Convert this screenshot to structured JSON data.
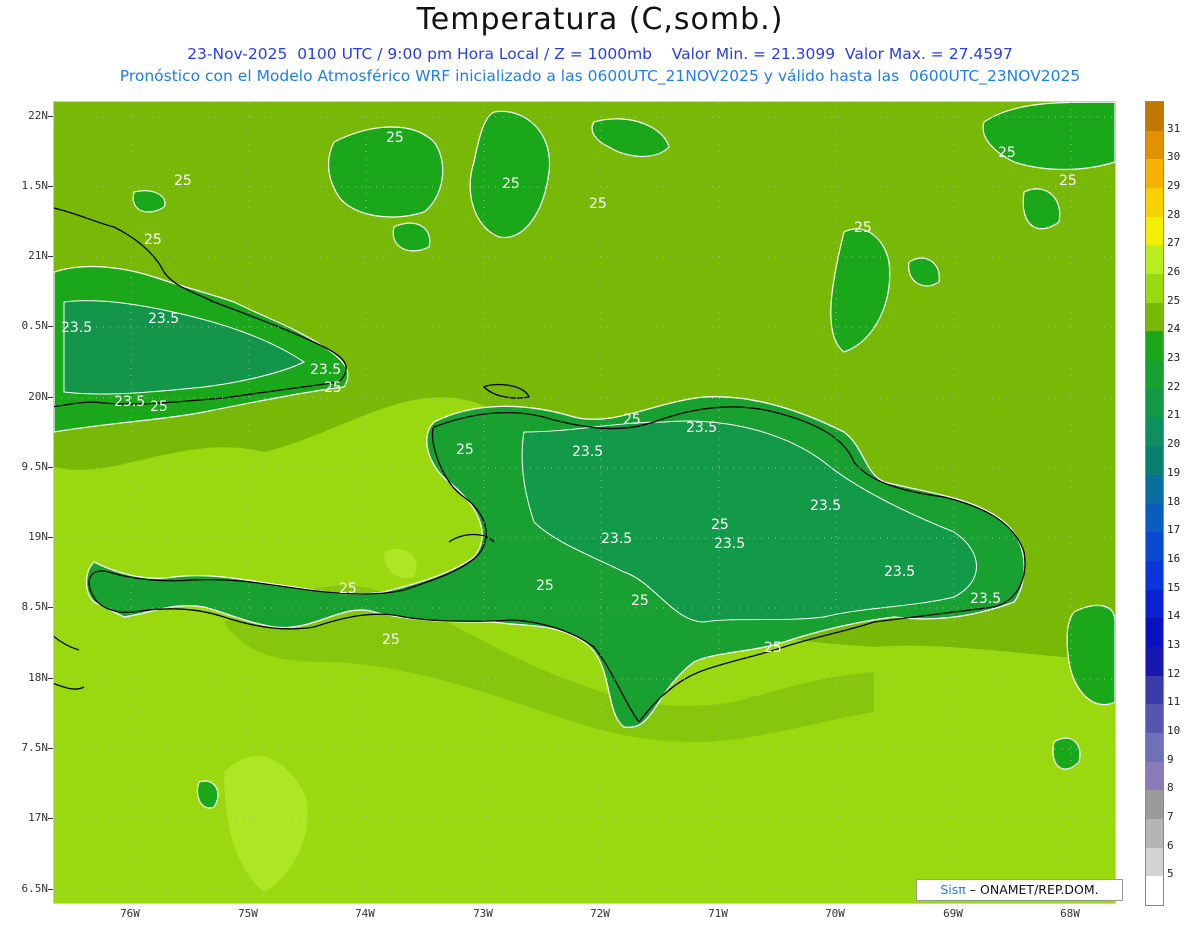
{
  "title": "Temperatura (C,somb.)",
  "subtitle_line1": "23-Nov-2025  0100 UTC / 9:00 pm Hora Local / Z = 1000mb    Valor Min. = 21.3099  Valor Max. = 27.4597",
  "subtitle_line2": "Pronóstico con el Modelo Atmosférico WRF inicializado a las 0600UTC_21NOV2025 y válido hasta las  0600UTC_23NOV2025",
  "lat_labels": [
    "22N",
    "1.5N",
    "21N",
    "0.5N",
    "20N",
    "9.5N",
    "19N",
    "8.5N",
    "18N",
    "7.5N",
    "17N",
    "6.5N"
  ],
  "lon_labels": [
    "76W",
    "75W",
    "74W",
    "73W",
    "72W",
    "71W",
    "70W",
    "69W",
    "68W"
  ],
  "contour_labels": [
    "25",
    "25",
    "25",
    "25",
    "25",
    "25",
    "25",
    "25",
    "25",
    "25",
    "25",
    "25",
    "25",
    "25",
    "25",
    "25",
    "25",
    "25",
    "23.5",
    "23.5",
    "23.5",
    "23.5",
    "23.5",
    "23.5",
    "23.5",
    "23.5",
    "23.5",
    "23.5",
    "23.5"
  ],
  "colorbar": {
    "labels": [
      "31",
      "30",
      "29",
      "28",
      "27",
      "26",
      "25",
      "24",
      "23",
      "22",
      "21",
      "20",
      "19",
      "18",
      "17",
      "16",
      "15",
      "14",
      "13",
      "12",
      "11",
      "10",
      "9",
      "8",
      "7",
      "6",
      "5"
    ],
    "colors": [
      "#c07800",
      "#e09000",
      "#f5b000",
      "#f7d000",
      "#f2f000",
      "#b8ee20",
      "#9ad810",
      "#78b807",
      "#1aa81a",
      "#18a030",
      "#139a48",
      "#0e8f60",
      "#0a8070",
      "#0a6fa0",
      "#0a5cc0",
      "#0a48d0",
      "#0a35d8",
      "#0a22d0",
      "#0a12c0",
      "#1818b0",
      "#3a3aa8",
      "#5656b0",
      "#7070b8",
      "#8a7ab8",
      "#9a9a9a",
      "#b4b4b4",
      "#d4d4d4",
      "#ffffff"
    ]
  },
  "credit": {
    "sis": "Sisπ",
    "rest": "– ONAMET/REP.DOM."
  }
}
